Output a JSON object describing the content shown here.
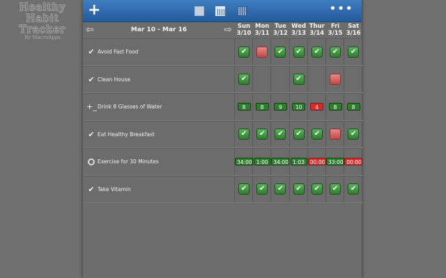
{
  "logo": {
    "line1": "Healthy Habit",
    "line2": "Tracker",
    "sub": "By MacroApps"
  },
  "toolbar": {
    "add_label": "+",
    "more_label": "•••"
  },
  "nav": {
    "range": "Mar 10 - Mar 16",
    "prev": "⇦",
    "next": "⇨"
  },
  "days": [
    {
      "dow": "Sun",
      "date": "3/10"
    },
    {
      "dow": "Mon",
      "date": "3/11"
    },
    {
      "dow": "Tue",
      "date": "3/12"
    },
    {
      "dow": "Wed",
      "date": "3/13"
    },
    {
      "dow": "Thur",
      "date": "3/14"
    },
    {
      "dow": "Fri",
      "date": "3/15"
    },
    {
      "dow": "Sat",
      "date": "3/16"
    }
  ],
  "habits": [
    {
      "name": "Avoid Fast Food",
      "icon": "check-icon",
      "cells": [
        "done",
        "miss",
        "done",
        "done",
        "done",
        "done",
        "done"
      ]
    },
    {
      "name": "Clean House",
      "icon": "check-icon",
      "cells": [
        "done",
        "",
        "",
        "done",
        "",
        "miss",
        ""
      ]
    },
    {
      "name": "Drink 8 Glasses of Water",
      "icon": "plus-minus-icon",
      "cells": [
        {
          "v": "8",
          "s": "good"
        },
        {
          "v": "8",
          "s": "good"
        },
        {
          "v": "9",
          "s": "good"
        },
        {
          "v": "10",
          "s": "good"
        },
        {
          "v": "4",
          "s": "bad"
        },
        {
          "v": "8",
          "s": "good"
        },
        {
          "v": "8",
          "s": "good"
        }
      ]
    },
    {
      "name": "Eat Healthy Breakfast",
      "icon": "check-icon",
      "cells": [
        "done",
        "done",
        "done",
        "done",
        "done",
        "miss",
        "done"
      ]
    },
    {
      "name": "Exercise for 30 Minutes",
      "icon": "timer-icon",
      "cells": [
        {
          "v": "34:00",
          "s": "good"
        },
        {
          "v": "1:00",
          "s": "good"
        },
        {
          "v": "34:00",
          "s": "good"
        },
        {
          "v": "1:03",
          "s": "good"
        },
        {
          "v": "00:00",
          "s": "bad"
        },
        {
          "v": "33:00",
          "s": "good"
        },
        {
          "v": "00:00",
          "s": "bad"
        }
      ]
    },
    {
      "name": "Take Vitamin",
      "icon": "check-icon",
      "cells": [
        "done",
        "done",
        "done",
        "done",
        "done",
        "done",
        "done"
      ]
    }
  ],
  "colors": {
    "toolbar_top": "#3f7ec2",
    "toolbar_bottom": "#245a9a",
    "done": "#2f7d2f",
    "miss": "#c04848"
  }
}
